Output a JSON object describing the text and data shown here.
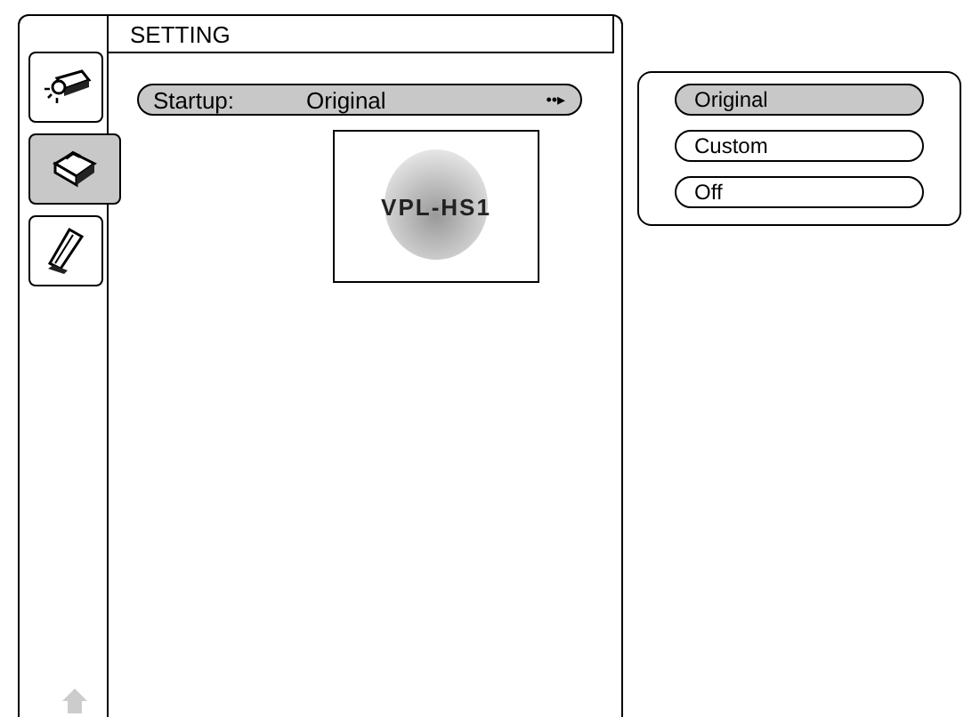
{
  "menu": {
    "title": "SETTING",
    "tabs": [
      {
        "kind": "projector",
        "selected": false
      },
      {
        "kind": "toolbox",
        "selected": true
      },
      {
        "kind": "stand",
        "selected": false
      }
    ],
    "startup": {
      "label": "Startup:",
      "value": "Original",
      "arrow": "••▸"
    },
    "logo_text": "VPL-HS1"
  },
  "options": [
    {
      "label": "Original",
      "selected": true
    },
    {
      "label": "Custom",
      "selected": false
    },
    {
      "label": "Off",
      "selected": false
    }
  ]
}
